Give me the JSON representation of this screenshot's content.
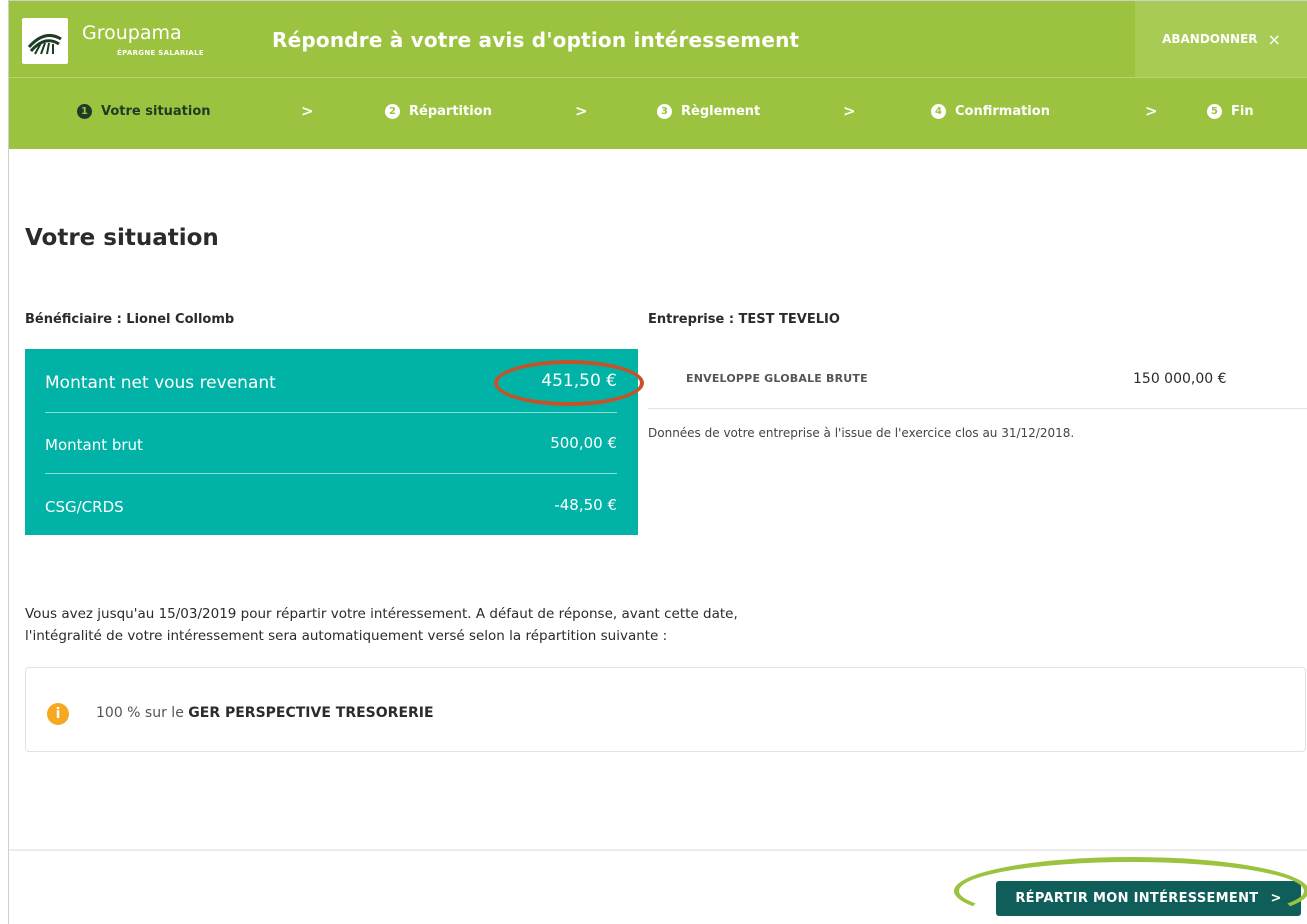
{
  "header": {
    "brand": "Groupama",
    "brand_sub": "ÉPARGNE SALARIALE",
    "title": "Répondre à votre avis d'option intéressement",
    "abandon_label": "ABANDONNER",
    "abandon_icon": "×"
  },
  "steps": [
    {
      "num": "1",
      "label": "Votre situation"
    },
    {
      "num": "2",
      "label": "Répartition"
    },
    {
      "num": "3",
      "label": "Règlement"
    },
    {
      "num": "4",
      "label": "Confirmation"
    },
    {
      "num": "5",
      "label": "Fin"
    }
  ],
  "step_separator": ">",
  "main": {
    "title": "Votre situation",
    "beneficiaire": "Bénéficiaire : Lionel Collomb",
    "entreprise": "Entreprise : TEST TEVELIO",
    "amounts": [
      {
        "label": "Montant net vous revenant",
        "value": "451,50 €"
      },
      {
        "label": "Montant brut",
        "value": "500,00 €"
      },
      {
        "label": "CSG/CRDS",
        "value": "-48,50 €"
      }
    ],
    "envelope_label": "ENVELOPPE GLOBALE BRUTE",
    "envelope_value": "150 000,00 €",
    "envelope_note": "Données de votre entreprise à l'issue de l'exercice clos au 31/12/2018.",
    "deadline_line1": "Vous avez jusqu'au 15/03/2019 pour répartir votre intéressement. A défaut de réponse, avant cette date,",
    "deadline_line2": "l'intégralité de votre intéressement sera automatiquement versé selon la répartition suivante :",
    "default_prefix": "100 % sur le ",
    "default_fund": "GER PERSPECTIVE TRESORERIE"
  },
  "footer": {
    "cta_label": "RÉPARTIR MON INTÉRESSEMENT",
    "cta_icon": ">"
  },
  "colors": {
    "header_green": "#9cc33f",
    "card_teal": "#00b3a6",
    "cta_dark_teal": "#0f5e5a",
    "info_orange": "#f7a823",
    "annotation_red": "#c5532a"
  }
}
